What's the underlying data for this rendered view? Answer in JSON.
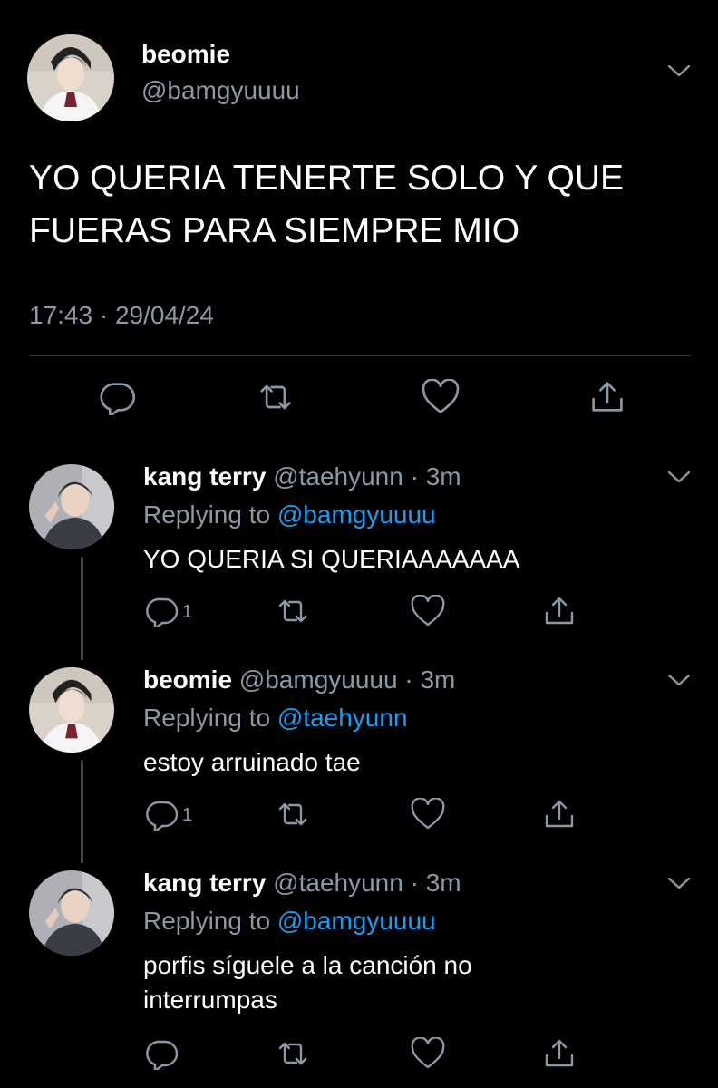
{
  "main_tweet": {
    "author_name": "beomie",
    "author_handle": "@bamgyuuuu",
    "text": "YO QUERIA TENERTE SOLO Y QUE FUERAS PARA SIEMPRE MIO",
    "timestamp": "17:43 · 29/04/24",
    "actions": [
      "reply-icon",
      "retweet-icon",
      "like-icon",
      "share-icon"
    ]
  },
  "replies": [
    {
      "author_name": "kang terry",
      "author_handle": "@taehyunn",
      "time": "3m",
      "replying_prefix": "Replying to",
      "replying_to": "@bamgyuuuu",
      "text": "YO QUERIA SI QUERIAAAAAAA",
      "reply_count": "1"
    },
    {
      "author_name": "beomie",
      "author_handle": "@bamgyuuuu",
      "time": "3m",
      "replying_prefix": "Replying to",
      "replying_to": "@taehyunn",
      "text": "estoy arruinado tae",
      "reply_count": "1"
    },
    {
      "author_name": "kang terry",
      "author_handle": "@taehyunn",
      "time": "3m",
      "replying_prefix": "Replying to",
      "replying_to": "@bamgyuuuu",
      "text": "porfis síguele a la canción no interrumpas",
      "reply_count": ""
    }
  ],
  "colors": {
    "background": "#000000",
    "text": "#ffffff",
    "muted": "#8b98a5",
    "mention": "#1d9bf0",
    "divider": "#2f3336"
  }
}
